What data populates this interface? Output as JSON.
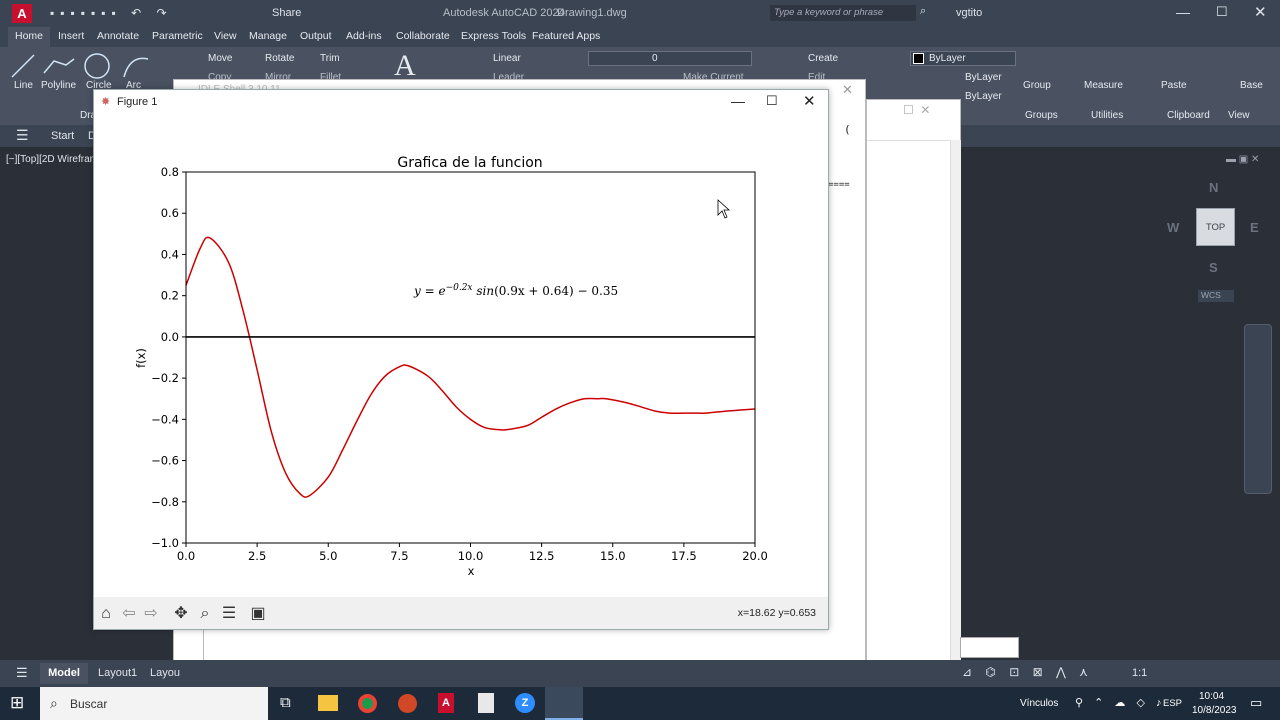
{
  "app": {
    "title": "Autodesk AutoCAD 2024",
    "document": "Drawing1.dwg",
    "share_label": "Share",
    "search_placeholder": "Type a keyword or phrase",
    "user": "vgtito"
  },
  "ribbon": {
    "tabs": [
      "Home",
      "Insert",
      "Annotate",
      "Parametric",
      "View",
      "Manage",
      "Output",
      "Add-ins",
      "Collaborate",
      "Express Tools",
      "Featured Apps"
    ],
    "draw_tools": [
      "Line",
      "Polyline",
      "Circle",
      "Arc"
    ],
    "modify_tools": [
      "Move",
      "Rotate",
      "Trim",
      "Copy",
      "Mirror",
      "Fillet"
    ],
    "annotation": {
      "linear": "Linear",
      "leader": "Leader"
    },
    "layer_value": "0",
    "make_current": "Make Current",
    "block": {
      "create": "Create",
      "edit": "Edit"
    },
    "properties": {
      "color": "ByLayer",
      "linetype": "ByLayer",
      "lineweight": "ByLayer"
    },
    "right_tools": [
      "Group",
      "Measure",
      "Paste",
      "Base"
    ],
    "panels": [
      "Groups",
      "Utilities",
      "Clipboard",
      "View"
    ],
    "draw_panel_partial": "Dra",
    "match_partial": "tch",
    "properties_partial": "rties"
  },
  "filetabs": {
    "start": "Start",
    "partial": "D"
  },
  "viewport": {
    "label": "[−][Top][2D Wirefran",
    "viewcube_top": "TOP",
    "compass": {
      "n": "N",
      "s": "S",
      "e": "E",
      "w": "W"
    },
    "wcs": "WCS"
  },
  "bg_window": {
    "title": "IDLE Shell 3.10.11",
    "prompt": "(",
    "sep": "===="
  },
  "statusbar": {
    "model": "Model",
    "layouts": [
      "Layout1",
      "Layou"
    ],
    "scale": "1:1"
  },
  "figure": {
    "title": "Figure 1",
    "cursor_readout": "x=18.62 y=0.653"
  },
  "chart_data": {
    "type": "line",
    "title": "Grafica de la funcion",
    "xlabel": "x",
    "ylabel": "f(x)",
    "xlim": [
      0,
      20
    ],
    "ylim": [
      -1.0,
      0.8
    ],
    "xticks": [
      "0.0",
      "2.5",
      "5.0",
      "7.5",
      "10.0",
      "12.5",
      "15.0",
      "17.5",
      "20.0"
    ],
    "yticks": [
      "0.8",
      "0.6",
      "0.4",
      "0.2",
      "0.0",
      "−0.2",
      "−0.4",
      "−0.6",
      "−0.8",
      "−1.0"
    ],
    "annotation": "y = e^{−0.2x} sin(0.9x + 0.64) − 0.35",
    "series": [
      {
        "color": "#cc0000",
        "x": [
          0,
          0.5,
          0.84,
          1.5,
          2.0,
          2.5,
          3.0,
          3.5,
          4.0,
          4.34,
          5.0,
          5.5,
          6.0,
          6.5,
          7.0,
          7.5,
          7.81,
          8.5,
          9.0,
          9.5,
          10.0,
          10.5,
          11.0,
          11.29,
          12.0,
          12.5,
          13.0,
          13.5,
          14.0,
          14.5,
          14.77,
          15.5,
          16.0,
          16.5,
          17.0,
          17.5,
          18.0,
          18.26,
          19.0,
          19.5,
          20.0
        ],
        "y": [
          0.25,
          0.43,
          0.48,
          0.36,
          0.13,
          -0.16,
          -0.46,
          -0.66,
          -0.76,
          -0.77,
          -0.68,
          -0.55,
          -0.41,
          -0.28,
          -0.19,
          -0.145,
          -0.14,
          -0.19,
          -0.26,
          -0.34,
          -0.4,
          -0.44,
          -0.45,
          -0.45,
          -0.43,
          -0.39,
          -0.35,
          -0.32,
          -0.3,
          -0.3,
          -0.3,
          -0.32,
          -0.34,
          -0.36,
          -0.37,
          -0.37,
          -0.37,
          -0.37,
          -0.36,
          -0.355,
          -0.35
        ]
      },
      {
        "color": "#000000",
        "x": [
          0,
          20
        ],
        "y": [
          0,
          0
        ]
      }
    ]
  },
  "taskbar": {
    "search": "Buscar",
    "links": "Vínculos",
    "lang": "ESP",
    "time": "10:04",
    "date": "10/8/2023"
  }
}
